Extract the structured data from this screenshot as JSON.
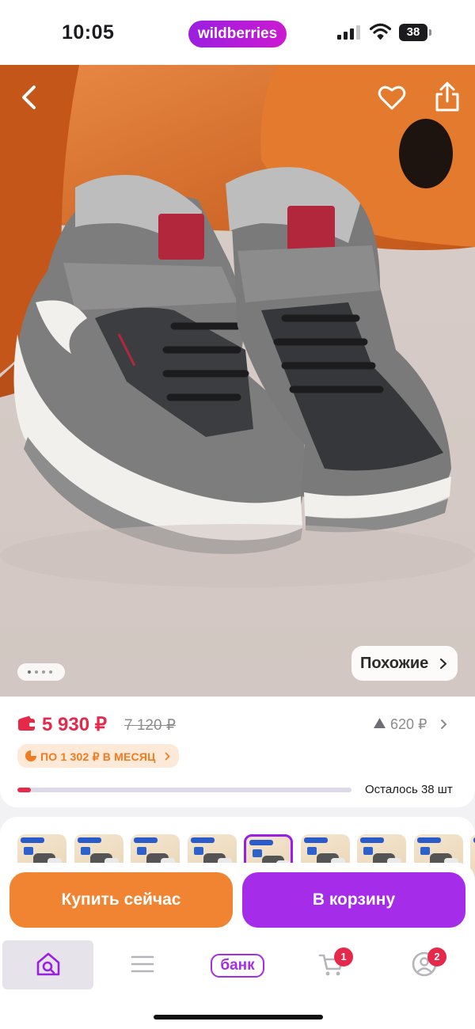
{
  "status_bar": {
    "time": "10:05",
    "brand": "wildberries",
    "battery": "38",
    "icons": [
      "signal-icon",
      "wifi-icon",
      "battery-icon"
    ]
  },
  "product_image": {
    "icons": [
      "chevron-left-icon",
      "heart-icon",
      "share-icon"
    ],
    "similar_label": "Похожие",
    "carousel": {
      "count": 4,
      "active_index": 0
    }
  },
  "price": {
    "current": "5 930 ₽",
    "old": "7 120 ₽",
    "points": "620 ₽",
    "installment": "ПО 1 302 ₽ В МЕСЯЦ",
    "stock_label": "Осталось 38 шт",
    "stock_level": 0.04,
    "accent_color": "#e6294b"
  },
  "thumbnails": {
    "count": 9,
    "selected_index": 4
  },
  "actions": {
    "buy_now_label": "Купить сейчас",
    "add_to_cart_label": "В корзину",
    "buy_now_color": "#f08432",
    "add_to_cart_color": "#a52ce8"
  },
  "tab_bar": {
    "items": [
      {
        "name": "home-search",
        "icon": "home-search-icon",
        "active": true
      },
      {
        "name": "catalog",
        "icon": "menu-icon"
      },
      {
        "name": "bank",
        "label": "банк"
      },
      {
        "name": "cart",
        "icon": "cart-icon",
        "badge": "1"
      },
      {
        "name": "profile",
        "icon": "profile-icon",
        "badge": "2"
      }
    ]
  }
}
